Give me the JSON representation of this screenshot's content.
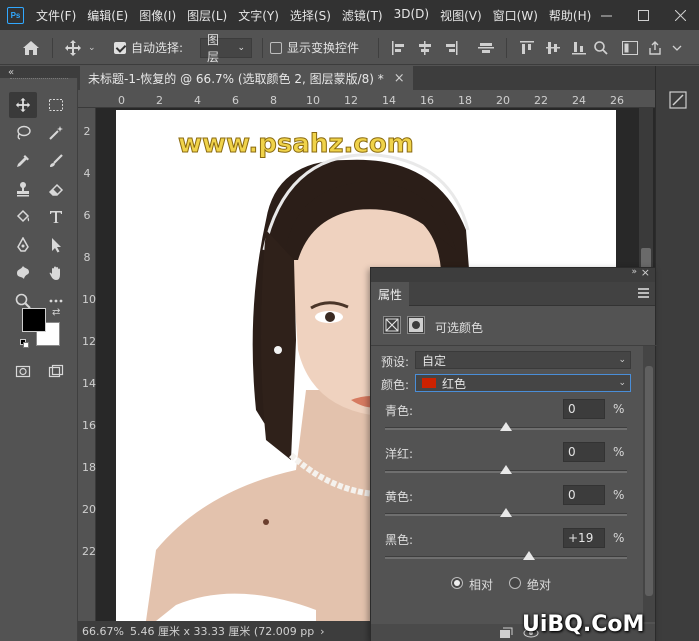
{
  "app": {
    "logo_text": "Ps"
  },
  "menubar": {
    "items": [
      "文件(F)",
      "编辑(E)",
      "图像(I)",
      "图层(L)",
      "文字(Y)",
      "选择(S)",
      "滤镜(T)",
      "3D(D)",
      "视图(V)",
      "窗口(W)",
      "帮助(H)"
    ]
  },
  "optionsbar": {
    "auto_select_label": "自动选择:",
    "auto_select_checked": true,
    "auto_select_target": "图层",
    "show_transform_label": "显示变换控件",
    "show_transform_checked": false
  },
  "document": {
    "tab_title": "未标题-1-恢复的 @ 66.7% (选取颜色 2, 图层蒙版/8) *",
    "close_glyph": "×"
  },
  "rulers": {
    "top": [
      "0",
      "2",
      "4",
      "6",
      "8",
      "10",
      "12",
      "14",
      "16",
      "18",
      "20",
      "22",
      "24",
      "26"
    ],
    "left": [
      "2",
      "4",
      "6",
      "8",
      "10",
      "12",
      "14",
      "16",
      "18",
      "20",
      "22"
    ]
  },
  "canvas": {
    "watermark_text": "www.psahz.com",
    "image_description_icon": "portrait-photo"
  },
  "statusbar": {
    "zoom": "66.67%",
    "doc_info": "5.46 厘米 x 33.33 厘米 (72.009 pp",
    "nav_glyph": "›"
  },
  "properties": {
    "tab_label": "属性",
    "adjustment_title": "可选颜色",
    "preset_label": "预设:",
    "preset_value": "自定",
    "colors_label": "颜色:",
    "colors_value": "红色",
    "colors_swatch": "#cc2200",
    "sliders": [
      {
        "label": "青色:",
        "value": "0",
        "unit": "%",
        "level": 0
      },
      {
        "label": "洋红:",
        "value": "0",
        "unit": "%",
        "level": 0
      },
      {
        "label": "黄色:",
        "value": "0",
        "unit": "%",
        "level": 0
      },
      {
        "label": "黑色:",
        "value": "+19",
        "unit": "%",
        "level": 19
      }
    ],
    "method_relative": "相对",
    "method_absolute": "绝对",
    "method_selected": "relative"
  },
  "corner_watermark": "UiBQ.CoM",
  "colors": {
    "foreground": "#000000",
    "background": "#ffffff",
    "accent": "#4a8ed8"
  }
}
